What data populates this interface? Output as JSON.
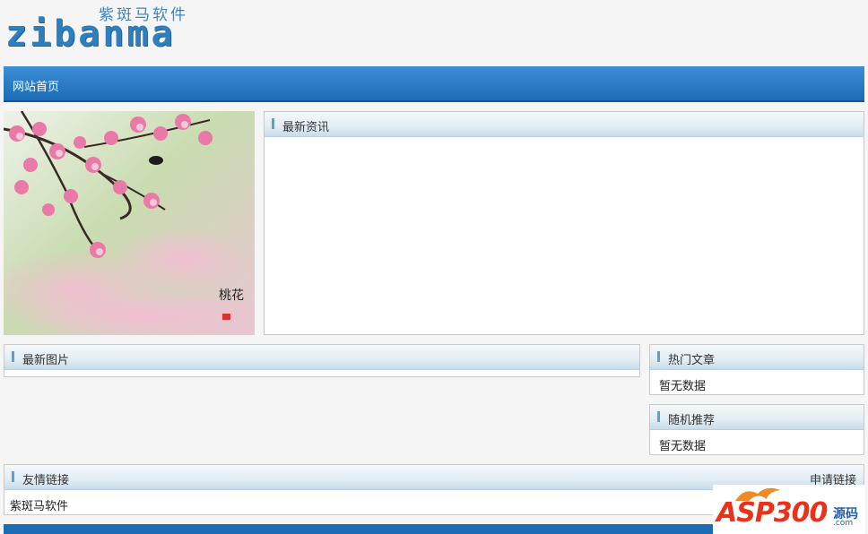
{
  "logo": {
    "cn": "紫斑马软件",
    "en": "zibanma"
  },
  "nav": {
    "items": [
      "网站首页"
    ]
  },
  "photo": {
    "caption": "桃花"
  },
  "latest_news": {
    "title": "最新资讯"
  },
  "latest_pics": {
    "title": "最新图片"
  },
  "hot_articles": {
    "title": "热门文章",
    "empty": "暂无数据"
  },
  "random_recommend": {
    "title": "随机推荐",
    "empty": "暂无数据"
  },
  "friend_links": {
    "title": "友情链接",
    "apply": "申请链接",
    "items": [
      "紫斑马软件"
    ]
  },
  "watermark": {
    "text": "ASP300",
    "tag": "源码",
    "domain": ".com"
  }
}
